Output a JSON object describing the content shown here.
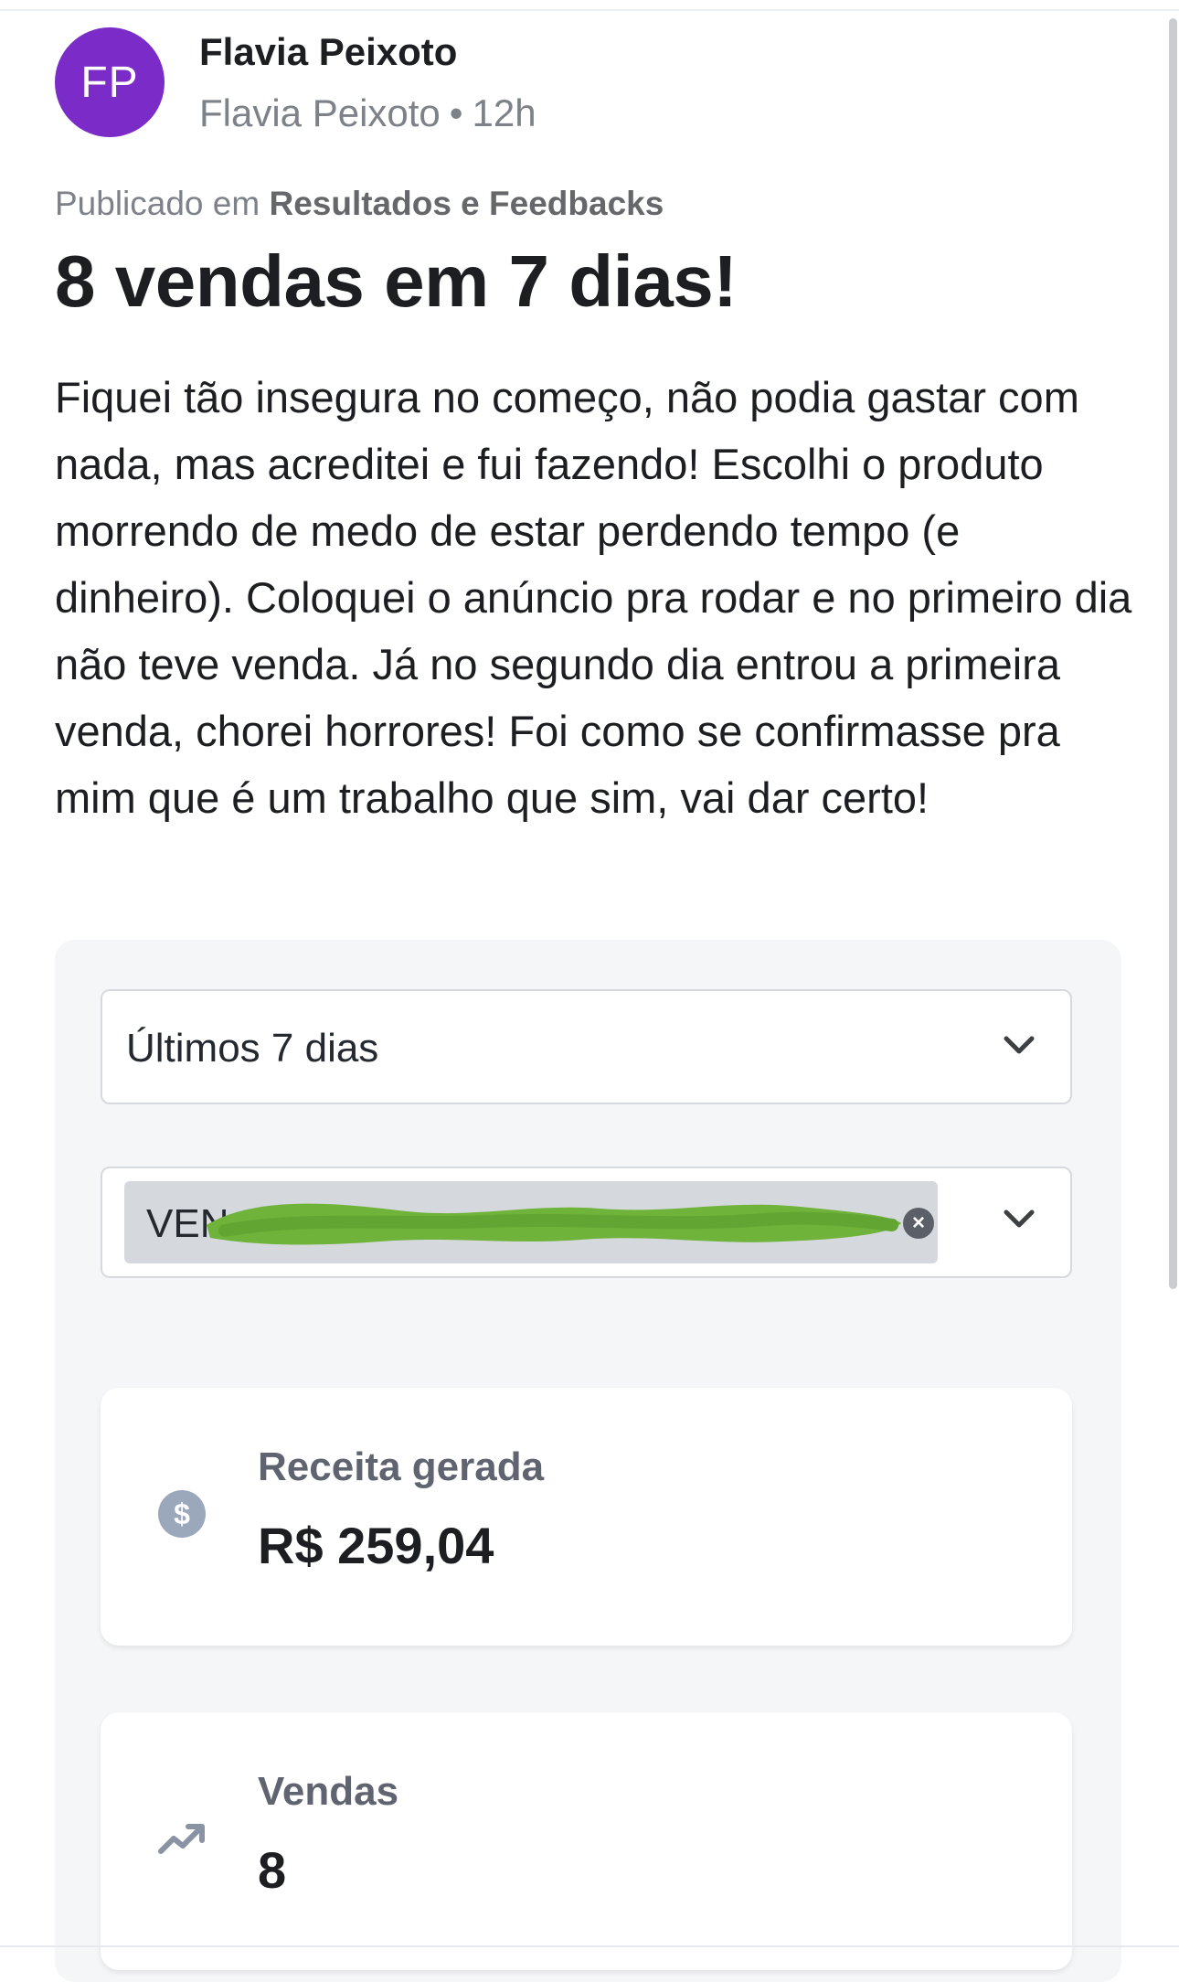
{
  "post": {
    "avatar_initials": "FP",
    "author_name": "Flavia Peixoto",
    "author_subname": "Flavia Peixoto",
    "separator": "•",
    "time": "12h",
    "published_prefix": "Publicado em",
    "group_name": "Resultados e Feedbacks",
    "title": "8 vendas em 7 dias!",
    "body": "Fiquei tão insegura no começo, não podia gastar com nada, mas acreditei e fui fazendo! Escolhi o produto morrendo de medo de estar perdendo tempo (e dinheiro). Coloquei o anúncio pra rodar e no primeiro dia não teve venda. Já no segundo dia entrou a primeira venda, chorei horrores! Foi como se confirmasse pra mim que é um trabalho que sim, vai dar certo!"
  },
  "dashboard": {
    "period_select": {
      "value": "Últimos 7 dias",
      "icon": "chevron-down-icon"
    },
    "product_select": {
      "chip_text": "VEN",
      "chip_redacted": true,
      "redaction_color": "#6fb33a",
      "clear_icon": "close-circle-icon",
      "icon": "chevron-down-icon"
    },
    "stats": [
      {
        "label": "Receita gerada",
        "value": "R$ 259,04",
        "icon": "dollar-circle-icon",
        "icon_color": "#9ba7ba"
      },
      {
        "label": "Vendas",
        "value": "8",
        "icon": "trending-up-icon",
        "icon_color": "#8a93a3"
      }
    ]
  },
  "colors": {
    "avatar_bg": "#7b2bc7",
    "card_bg": "#f5f6f8",
    "muted_text": "#7d8289"
  }
}
